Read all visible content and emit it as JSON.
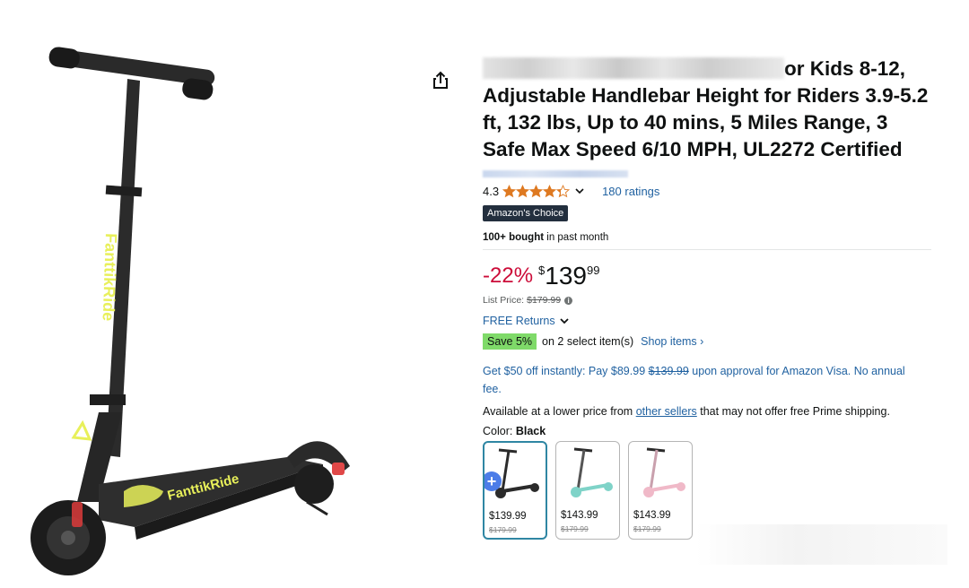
{
  "product": {
    "title_visible": "or Kids 8-12, Adjustable Handlebar Height for Riders 3.9-5.2 ft, 132 lbs, Up to 40 mins, 5 Miles Range, 3 Safe Max Speed 6/10 MPH, UL2272 Certified",
    "title_line1": "or Kids 8-12,",
    "title_line2": "Adjustable Handlebar Height for Riders 3.9-5.2",
    "title_line3": "ft, 132 lbs, Up to 40 mins, 5 Miles Range, 3",
    "title_line4": "Safe Max Speed 6/10 MPH, UL2272 Certified",
    "scooter_brand_print": "FanttikRide"
  },
  "rating": {
    "value": "4.3",
    "stars": 4.3,
    "count_label": "180 ratings"
  },
  "badge": {
    "label": "Amazon's Choice"
  },
  "bought": {
    "bold": "100+ bought",
    "rest": " in past month"
  },
  "price": {
    "discount": "-22%",
    "currency": "$",
    "whole": "139",
    "fraction": "99",
    "list_label": "List Price:",
    "list_value": "$179.99"
  },
  "returns": {
    "label": "FREE Returns"
  },
  "coupon": {
    "badge": "Save 5%",
    "text": "on 2 select item(s)",
    "link": "Shop items ›"
  },
  "card_offer": {
    "text": "Get $50 off instantly: Pay $89.99 ",
    "strike": "$139.99",
    "rest": " upon approval for Amazon Visa. No annual fee."
  },
  "availability": {
    "pre": "Available at a lower price from ",
    "link": "other sellers",
    "post": " that may not offer free Prime shipping."
  },
  "color": {
    "label": "Color:",
    "value": "Black"
  },
  "swatches": [
    {
      "price": "$139.99",
      "list": "$179.99",
      "color": "#2b2b2b",
      "selected": true
    },
    {
      "price": "$143.99",
      "list": "$179.99",
      "color": "#7fd3c8",
      "selected": false
    },
    {
      "price": "$143.99",
      "list": "$179.99",
      "color": "#f0b9c8",
      "selected": false
    }
  ],
  "colors": {
    "accent_link": "#2162a1",
    "deal_red": "#cc0c39",
    "star": "#de7921",
    "scooter_accent": "#e8f05a"
  }
}
